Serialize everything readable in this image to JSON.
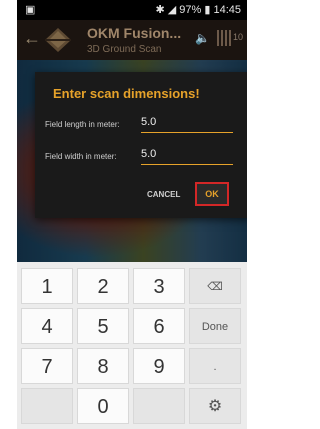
{
  "status": {
    "left": "▣",
    "right": "✱ ◢ 97% ▮ 14:45"
  },
  "app": {
    "title": "OKM Fusion...",
    "subtitle": "3D Ground Scan",
    "grid_count": "10"
  },
  "dialog": {
    "title": "Enter scan dimensions!",
    "fields": [
      {
        "label": "Field length in meter:",
        "value": "5.0"
      },
      {
        "label": "Field width in meter:",
        "value": "5.0"
      }
    ],
    "cancel_label": "CANCEL",
    "ok_label": "OK"
  },
  "keyboard": {
    "keys": [
      "1",
      "2",
      "3",
      "⌫",
      "4",
      "5",
      "6",
      "Done",
      "7",
      "8",
      "9",
      ".",
      "",
      "0",
      "",
      "⚙"
    ]
  },
  "colors": {
    "accent": "#e6a22a",
    "highlight": "#d32727"
  }
}
